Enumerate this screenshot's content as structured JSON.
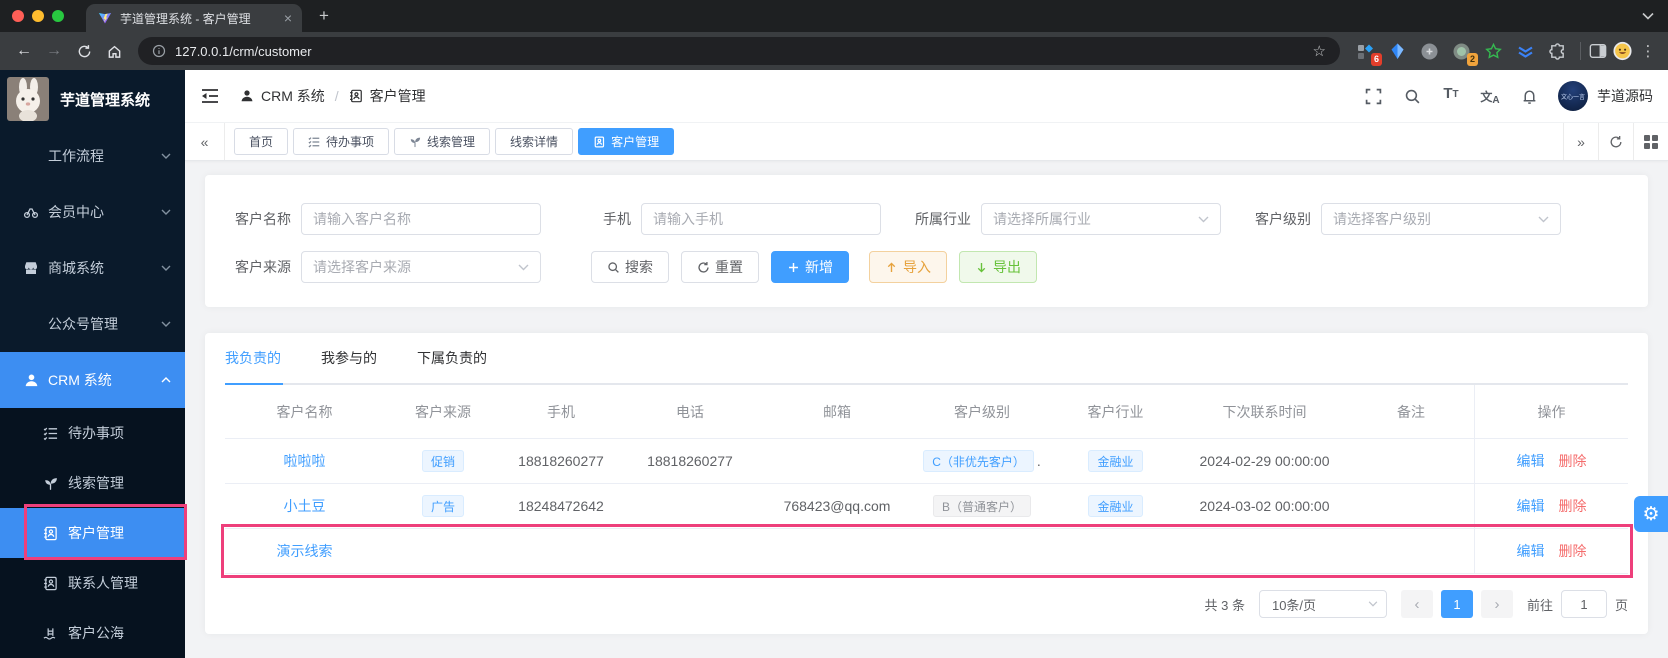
{
  "browser": {
    "tab_title": "芋道管理系统 - 客户管理",
    "url": "127.0.0.1/crm/customer",
    "ext_badge_grid": "6",
    "ext_badge_circle": "2"
  },
  "glyphs": {
    "back": "←",
    "forward": "→",
    "kebab": "⋮",
    "new_tab": "+",
    "close_tab": "×",
    "star": "☆",
    "collapse_left": "«",
    "expand_right": "»",
    "font_big": "T",
    "font_small": "T",
    "lang_zh": "文",
    "lang_a": "A",
    "gear": "⚙",
    "prev": "‹",
    "next": "›"
  },
  "sidebar": {
    "app_title": "芋道管理系统",
    "menu": [
      {
        "label": "工作流程"
      },
      {
        "label": "会员中心"
      },
      {
        "label": "商城系统"
      },
      {
        "label": "公众号管理"
      },
      {
        "label": "CRM 系统"
      }
    ],
    "submenu": [
      {
        "label": "待办事项"
      },
      {
        "label": "线索管理"
      },
      {
        "label": "客户管理"
      },
      {
        "label": "联系人管理"
      },
      {
        "label": "客户公海"
      }
    ]
  },
  "header": {
    "breadcrumb_root": "CRM 系统",
    "breadcrumb_sep": "/",
    "breadcrumb_current": "客户管理",
    "avatar_text": "文心一言",
    "username": "芋道源码"
  },
  "tagbar": {
    "tabs": [
      {
        "label": "首页"
      },
      {
        "label": "待办事项"
      },
      {
        "label": "线索管理"
      },
      {
        "label": "线索详情"
      },
      {
        "label": "客户管理"
      }
    ]
  },
  "filter": {
    "fields": {
      "name": {
        "label": "客户名称",
        "placeholder": "请输入客户名称"
      },
      "mobile": {
        "label": "手机",
        "placeholder": "请输入手机"
      },
      "industry": {
        "label": "所属行业",
        "placeholder": "请选择所属行业"
      },
      "level": {
        "label": "客户级别",
        "placeholder": "请选择客户级别"
      },
      "source": {
        "label": "客户来源",
        "placeholder": "请选择客户来源"
      }
    },
    "buttons": {
      "search": "搜索",
      "reset": "重置",
      "add": "新增",
      "import": "导入",
      "export": "导出"
    }
  },
  "list": {
    "tabs": [
      "我负责的",
      "我参与的",
      "下属负责的"
    ],
    "columns": [
      "客户名称",
      "客户来源",
      "手机",
      "电话",
      "邮箱",
      "客户级别",
      "客户行业",
      "下次联系时间",
      "备注",
      "操作"
    ],
    "rows": [
      {
        "name": "啦啦啦",
        "source": "促销",
        "mobile": "18818260277",
        "phone": "18818260277",
        "email": "",
        "level": "C（非优先客户）",
        "level_suffix": ".",
        "industry": "金融业",
        "next_time": "2024-02-29 00:00:00",
        "remark": ""
      },
      {
        "name": "小土豆",
        "source": "广告",
        "mobile": "18248472642",
        "phone": "",
        "email": "768423@qq.com",
        "level": "B（普通客户）",
        "level_suffix": "",
        "industry": "金融业",
        "next_time": "2024-03-02 00:00:00",
        "remark": ""
      },
      {
        "name": "演示线索",
        "source": "",
        "mobile": "",
        "phone": "",
        "email": "",
        "level": "",
        "level_suffix": "",
        "industry": "",
        "next_time": "",
        "remark": ""
      }
    ],
    "actions": {
      "edit": "编辑",
      "delete": "删除"
    }
  },
  "pagination": {
    "total": "共 3 条",
    "page_size": "10条/页",
    "page": "1",
    "goto": "前往",
    "goto_value": "1",
    "unit": "页"
  },
  "colors": {
    "accent": "#409eff",
    "annotation": "#ee3f7b",
    "danger": "#f56c6c",
    "warning": "#e6a23c",
    "success": "#67c23a",
    "sidebar_bg": "#0a1a2b"
  }
}
